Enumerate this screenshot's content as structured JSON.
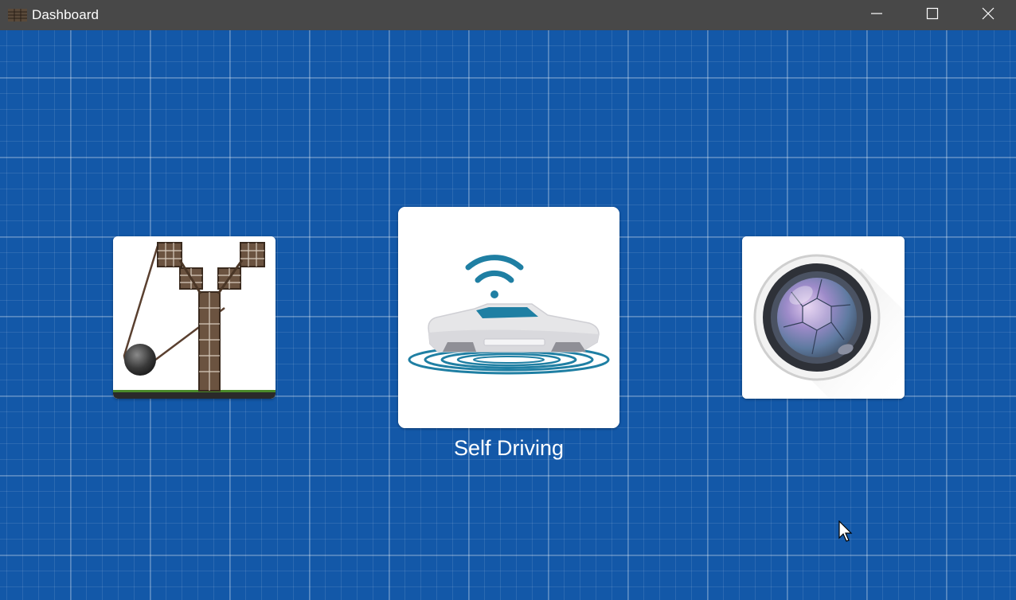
{
  "window": {
    "title": "Dashboard",
    "controls": [
      "minimize",
      "maximize",
      "close"
    ]
  },
  "tiles": [
    {
      "id": "tower",
      "icon": "tower-pulley-icon",
      "label": ""
    },
    {
      "id": "self-driving",
      "icon": "self-driving-car-icon",
      "label": "Self Driving"
    },
    {
      "id": "camera",
      "icon": "camera-lens-icon",
      "label": ""
    }
  ],
  "colors": {
    "titlebar": "#484848",
    "background": "#1358a8",
    "tile": "#ffffff",
    "accent": "#1f7fa3"
  }
}
